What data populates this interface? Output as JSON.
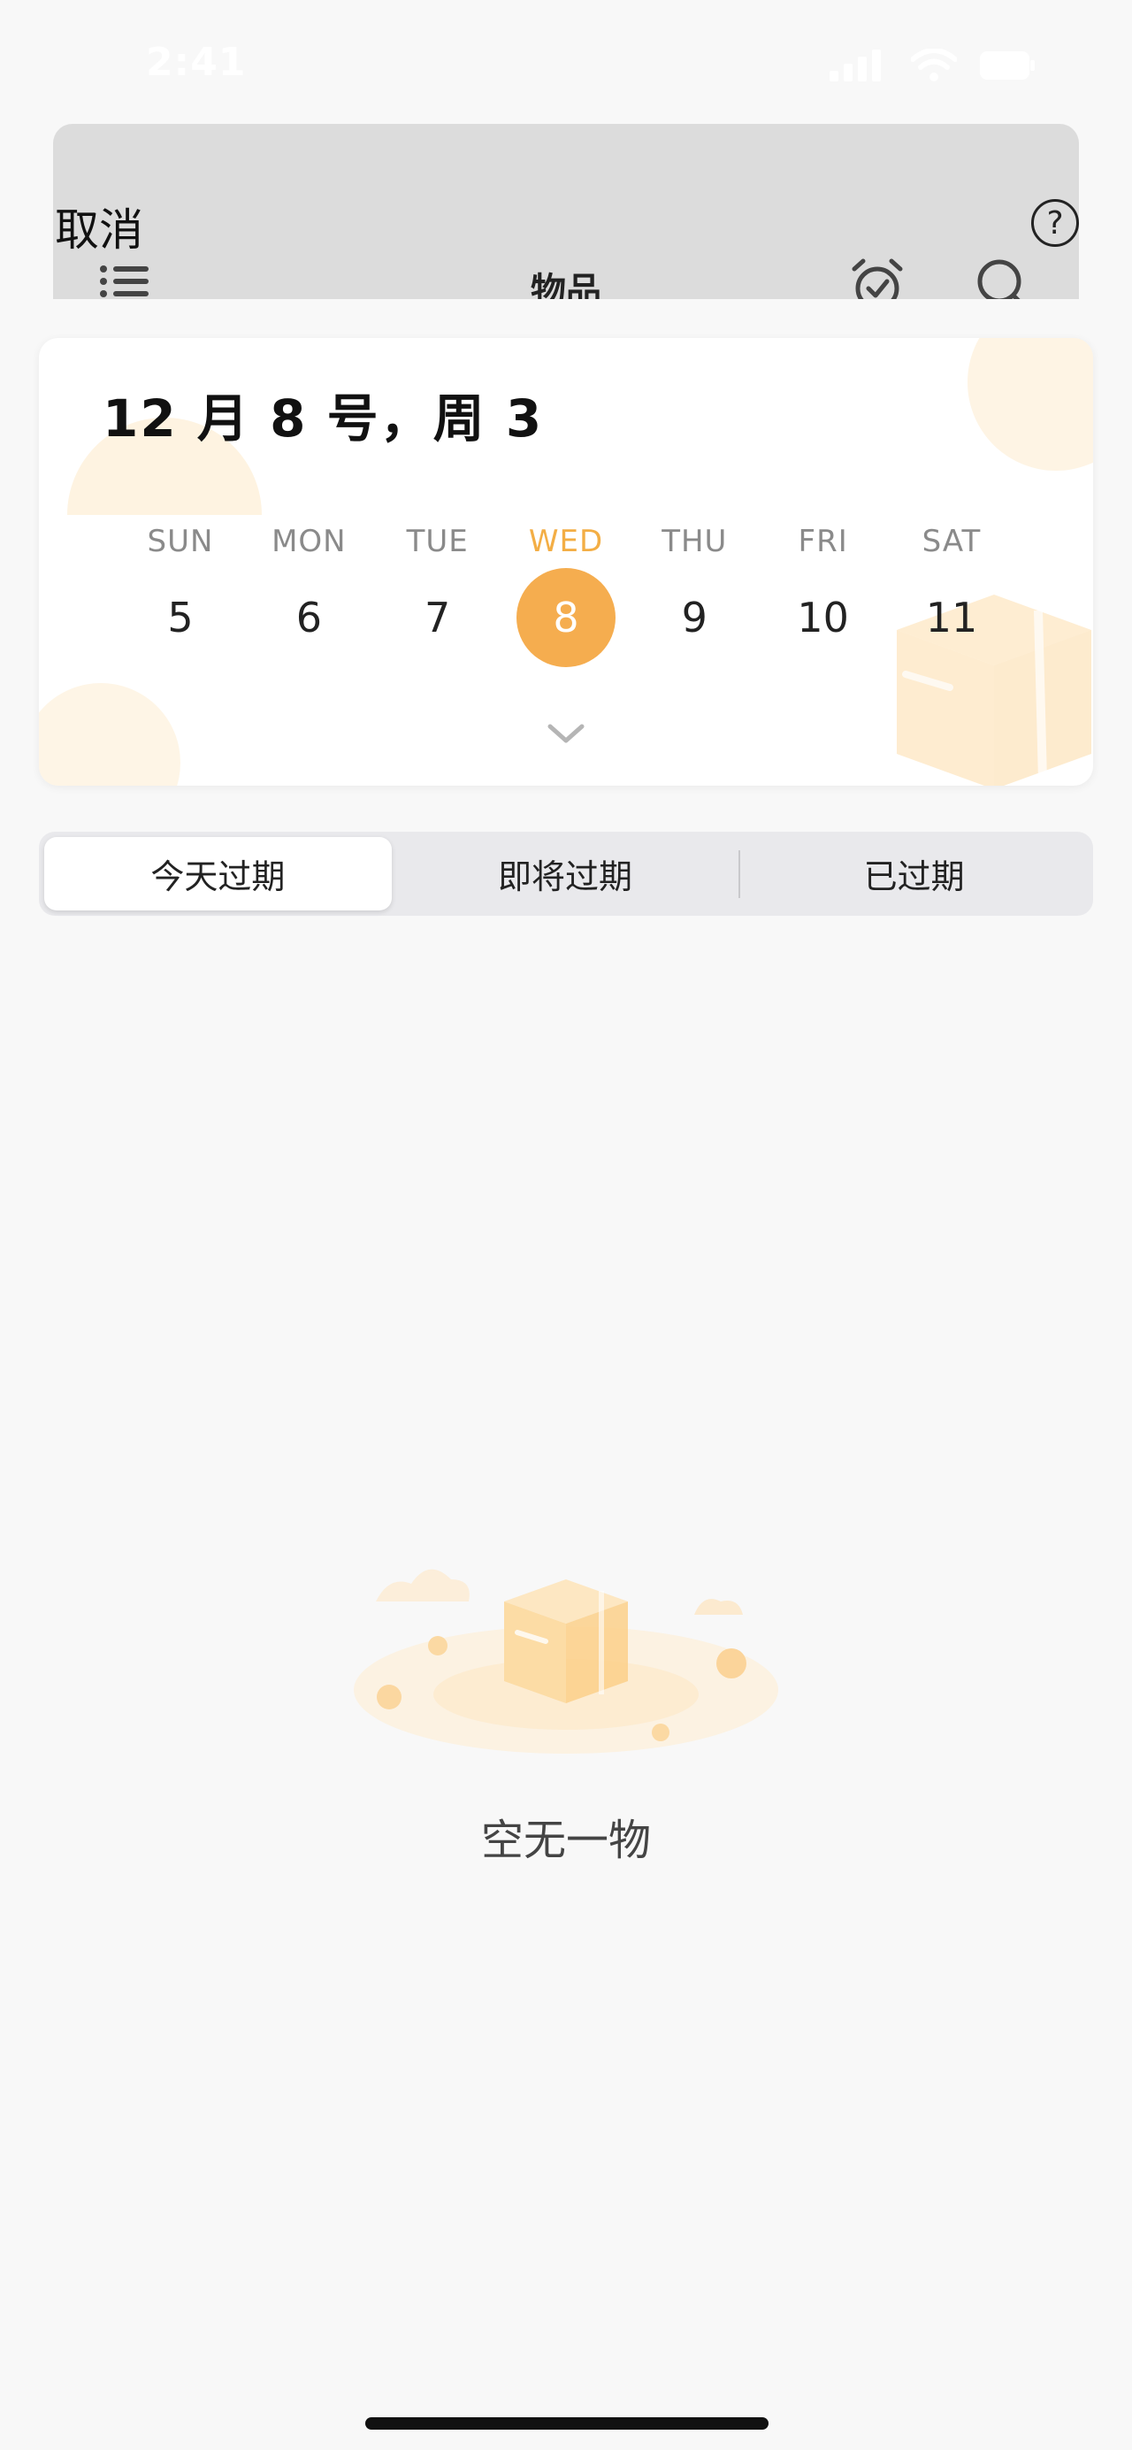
{
  "status_bar": {
    "time": "2:41"
  },
  "header": {
    "cancel_label": "取消",
    "help_label": "?",
    "title": "物品"
  },
  "calendar": {
    "date_heading": "12 月 8 号，周 3",
    "days": [
      {
        "name": "SUN",
        "num": "5"
      },
      {
        "name": "MON",
        "num": "6"
      },
      {
        "name": "TUE",
        "num": "7"
      },
      {
        "name": "WED",
        "num": "8"
      },
      {
        "name": "THU",
        "num": "9"
      },
      {
        "name": "FRI",
        "num": "10"
      },
      {
        "name": "SAT",
        "num": "11"
      }
    ],
    "selected_day": "8",
    "accent_color": "#f5ad4f"
  },
  "tabs": [
    {
      "label": "今天过期"
    },
    {
      "label": "即将过期"
    },
    {
      "label": "已过期"
    }
  ],
  "active_tab": "今天过期",
  "empty_state": {
    "text": "空无一物"
  },
  "icons": {
    "menu": "list-icon",
    "alarm": "alarm-check-icon",
    "search": "search-icon",
    "expand": "chevron-down-icon"
  }
}
